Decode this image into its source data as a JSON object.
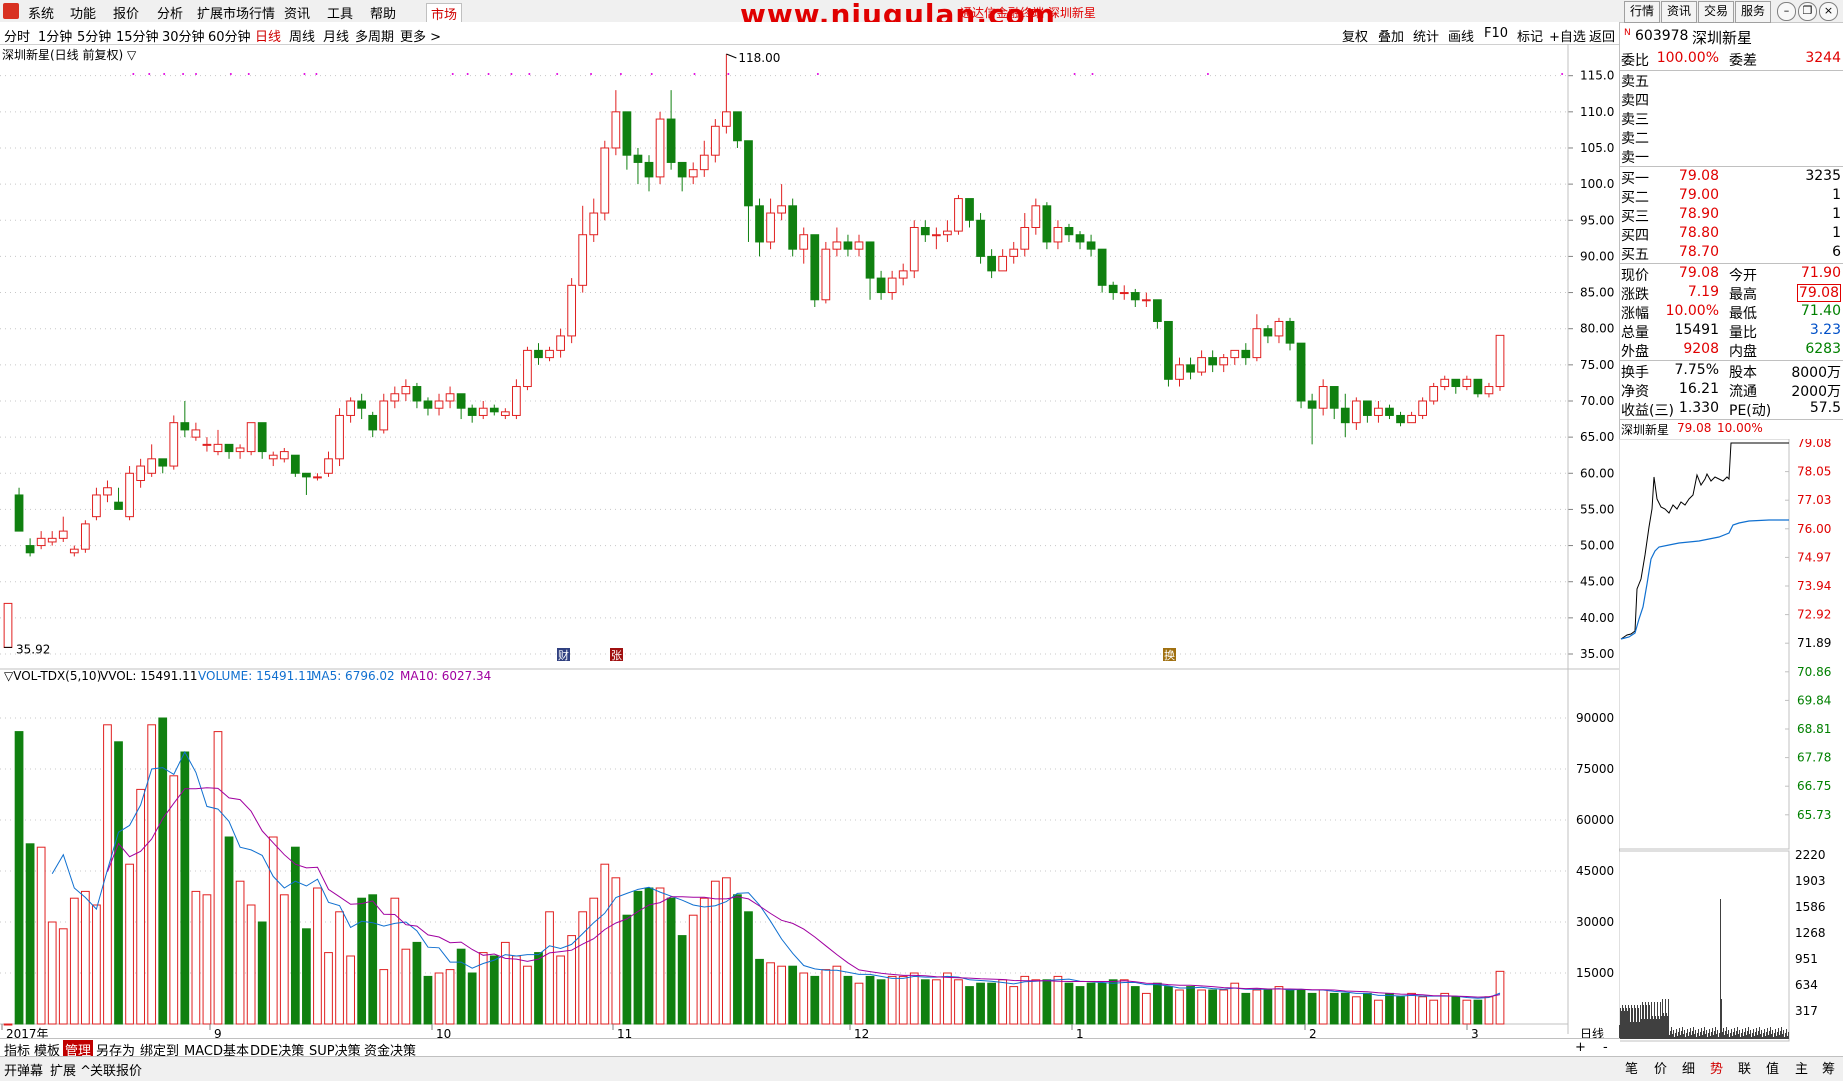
{
  "menu": {
    "items": [
      "系统",
      "功能",
      "报价",
      "分析",
      "扩展市场行情",
      "资讯",
      "工具",
      "帮助"
    ],
    "market_tab": "市场",
    "watermark": "www.niugulan.com",
    "watermark_sub": "通达信金融终端  深圳新星",
    "right_buttons": [
      "行情",
      "资讯",
      "交易",
      "服务"
    ]
  },
  "periods": {
    "items": [
      "分时",
      "1分钟",
      "5分钟",
      "15分钟",
      "30分钟",
      "60分钟",
      "日线",
      "周线",
      "月线",
      "多周期",
      "更多 >"
    ],
    "active": "日线"
  },
  "toolbar": {
    "items": [
      "复权",
      "叠加",
      "统计",
      "画线",
      "F10",
      "标记",
      "+自选",
      "返回"
    ]
  },
  "chart": {
    "title": "深圳新星(日线 前复权) ▽",
    "high_label": "118.00",
    "low_label": "35.92",
    "price_ticks": [
      "115.0",
      "110.0",
      "105.0",
      "100.0",
      "95.00",
      "90.00",
      "85.00",
      "80.00",
      "75.00",
      "70.00",
      "65.00",
      "60.00",
      "55.00",
      "50.00",
      "45.00",
      "40.00",
      "35.00"
    ],
    "volume_header": {
      "name": "▽VOL-TDX(5,10)",
      "vvol": "VVOL: 15491.11",
      "volume": "VOLUME: 15491.11",
      "ma5": "MA5: 6796.02",
      "ma10": "MA10: 6027.34"
    },
    "volume_ticks": [
      "90000",
      "75000",
      "60000",
      "45000",
      "30000",
      "15000"
    ],
    "date_ticks": [
      "2017年",
      "9",
      "10",
      "11",
      "12",
      "1",
      "2",
      "3"
    ],
    "period_label": "日线",
    "markers": [
      "财",
      "张",
      "换"
    ]
  },
  "chart_data": {
    "type": "candlestick",
    "title": "深圳新星(日线 前复权)",
    "ylim": [
      35,
      118
    ],
    "high": 118.0,
    "low": 35.92,
    "last_close": 79.08,
    "candles": [
      [
        35.9,
        42,
        42,
        35.9
      ],
      [
        57,
        52,
        58,
        52
      ],
      [
        50,
        49,
        51,
        48.5
      ],
      [
        50,
        51,
        52,
        49.5
      ],
      [
        50.5,
        51,
        52,
        50
      ],
      [
        51,
        52,
        54,
        50.5
      ],
      [
        49,
        49.5,
        50,
        48.5
      ],
      [
        49.5,
        53,
        53.5,
        49
      ],
      [
        54,
        57,
        58,
        53.5
      ],
      [
        57,
        58,
        59,
        56
      ],
      [
        56,
        55,
        58,
        55
      ],
      [
        54,
        60,
        61,
        53.5
      ],
      [
        59,
        61,
        62,
        58
      ],
      [
        60,
        62,
        64,
        59.5
      ],
      [
        62,
        61,
        62,
        60
      ],
      [
        61,
        67,
        68,
        60.5
      ],
      [
        67,
        66,
        70,
        65
      ],
      [
        65,
        66,
        67,
        64.5
      ],
      [
        64,
        64,
        65,
        63
      ],
      [
        63,
        64,
        66,
        62.5
      ],
      [
        64,
        63,
        64,
        62
      ],
      [
        63,
        63.5,
        64,
        62
      ],
      [
        63,
        67,
        67,
        62.5
      ],
      [
        67,
        63,
        67,
        62
      ],
      [
        62,
        62.5,
        63,
        61
      ],
      [
        62,
        63,
        63.5,
        61.5
      ],
      [
        62.5,
        60,
        62.5,
        59.5
      ],
      [
        60,
        59.5,
        60,
        57
      ],
      [
        59.5,
        59.5,
        60,
        59
      ],
      [
        60,
        62,
        63,
        59.5
      ],
      [
        62,
        68,
        69,
        61
      ],
      [
        68,
        70,
        70.5,
        67
      ],
      [
        70,
        69,
        71,
        67.5
      ],
      [
        68,
        66,
        68.5,
        65
      ],
      [
        66,
        70,
        71,
        65.5
      ],
      [
        70,
        71,
        72,
        69
      ],
      [
        71,
        72,
        73,
        70
      ],
      [
        72,
        70,
        72.5,
        69
      ],
      [
        70,
        69,
        70.5,
        68
      ],
      [
        69,
        70,
        71,
        68
      ],
      [
        70,
        71,
        72,
        69
      ],
      [
        71,
        69,
        71,
        67.5
      ],
      [
        69,
        68,
        69.5,
        67
      ],
      [
        68,
        69,
        70,
        67.5
      ],
      [
        69,
        68.5,
        69.5,
        68
      ],
      [
        68,
        68.5,
        69,
        67.5
      ],
      [
        68,
        72,
        73,
        67.5
      ],
      [
        72,
        77,
        77.5,
        71.5
      ],
      [
        77,
        76,
        78,
        75
      ],
      [
        76,
        77,
        77.5,
        75.5
      ],
      [
        77,
        79,
        80,
        76
      ],
      [
        79,
        86,
        87,
        78
      ],
      [
        86,
        93,
        97,
        85
      ],
      [
        93,
        96,
        98,
        92
      ],
      [
        96,
        105,
        106,
        95
      ],
      [
        105,
        110,
        113,
        104
      ],
      [
        110,
        104,
        110,
        102
      ],
      [
        104,
        103,
        105,
        100
      ],
      [
        103,
        101,
        104,
        99
      ],
      [
        101,
        109,
        110,
        100
      ],
      [
        109,
        103,
        113,
        102
      ],
      [
        103,
        101,
        103,
        99
      ],
      [
        101,
        102,
        103,
        100
      ],
      [
        102,
        104,
        106,
        101
      ],
      [
        104,
        108,
        109,
        103
      ],
      [
        108,
        110,
        118,
        107
      ],
      [
        110,
        106,
        110,
        105
      ],
      [
        106,
        97,
        106,
        92
      ],
      [
        97,
        92,
        98,
        90
      ],
      [
        92,
        96,
        98,
        91
      ],
      [
        96,
        97,
        100,
        95
      ],
      [
        97,
        91,
        98,
        90
      ],
      [
        91,
        93,
        94,
        89
      ],
      [
        93,
        84,
        93,
        83
      ],
      [
        84,
        91,
        92,
        83.5
      ],
      [
        91,
        92,
        94,
        90
      ],
      [
        92,
        91,
        93,
        90
      ],
      [
        91,
        92,
        93,
        90
      ],
      [
        92,
        87,
        92,
        84
      ],
      [
        87,
        85,
        88,
        84
      ],
      [
        85,
        87,
        88,
        84
      ],
      [
        87,
        88,
        89,
        86
      ],
      [
        88,
        94,
        95,
        87
      ],
      [
        94,
        93,
        95,
        92
      ],
      [
        93,
        93,
        94,
        91
      ],
      [
        93,
        93.5,
        95,
        92
      ],
      [
        93.5,
        98,
        98.5,
        93
      ],
      [
        98,
        95,
        98,
        94
      ],
      [
        95,
        90,
        96,
        89
      ],
      [
        90,
        88,
        91,
        87
      ],
      [
        88,
        90,
        91,
        88
      ],
      [
        90,
        91,
        92,
        89
      ],
      [
        91,
        94,
        96,
        90
      ],
      [
        94,
        97,
        98,
        93
      ],
      [
        97,
        92,
        97.5,
        91
      ],
      [
        92,
        94,
        95,
        91
      ],
      [
        94,
        93,
        94.5,
        92
      ],
      [
        93,
        92,
        93.5,
        91
      ],
      [
        92,
        91,
        93,
        90
      ],
      [
        91,
        86,
        91,
        85
      ],
      [
        86,
        85,
        86.5,
        84
      ],
      [
        85,
        85,
        86,
        84
      ],
      [
        85,
        84,
        85.5,
        83
      ],
      [
        84,
        84,
        85,
        83
      ],
      [
        84,
        81,
        84,
        80
      ],
      [
        81,
        73,
        81,
        72
      ],
      [
        73,
        75,
        76,
        72
      ],
      [
        75,
        74,
        76,
        73
      ],
      [
        74,
        76,
        77,
        73.5
      ],
      [
        76,
        75,
        77,
        74
      ],
      [
        75,
        76,
        76.5,
        74
      ],
      [
        76,
        77,
        77,
        75
      ],
      [
        77,
        76,
        78,
        75
      ],
      [
        76,
        80,
        82,
        75.5
      ],
      [
        80,
        79,
        80.5,
        78
      ],
      [
        79,
        81,
        81.5,
        78
      ],
      [
        81,
        78,
        81.5,
        77
      ],
      [
        78,
        70,
        78,
        69
      ],
      [
        70,
        69,
        71,
        64
      ],
      [
        69,
        72,
        73,
        68
      ],
      [
        72,
        69,
        72,
        67.5
      ],
      [
        69,
        67,
        71,
        65
      ],
      [
        67,
        70,
        70.5,
        66
      ],
      [
        70,
        68,
        70,
        67
      ],
      [
        68,
        69,
        70,
        67
      ],
      [
        69,
        68,
        69.5,
        67.5
      ],
      [
        68,
        67,
        68.5,
        66.5
      ],
      [
        67,
        68,
        68.5,
        67
      ],
      [
        68,
        70,
        70.5,
        67.5
      ],
      [
        70,
        72,
        72.5,
        69.5
      ],
      [
        72,
        73,
        73.5,
        71.5
      ],
      [
        73,
        72,
        73,
        71
      ],
      [
        72,
        73,
        73.5,
        71.5
      ],
      [
        73,
        71,
        73,
        70.5
      ],
      [
        71,
        72,
        72.5,
        70.5
      ],
      [
        72,
        79.08,
        79.08,
        71.4
      ]
    ],
    "volume": [
      0,
      86000,
      53000,
      52000,
      30000,
      28000,
      37000,
      39000,
      35000,
      88000,
      83000,
      47000,
      69000,
      88000,
      90000,
      73000,
      80000,
      39000,
      38000,
      86000,
      55000,
      42000,
      35000,
      30000,
      55000,
      38000,
      52000,
      28000,
      40000,
      21000,
      33000,
      20000,
      37000,
      38000,
      16000,
      37000,
      22000,
      24000,
      14000,
      15000,
      16000,
      22000,
      15000,
      21000,
      20000,
      24000,
      20000,
      17000,
      21000,
      33000,
      20000,
      26000,
      33000,
      37000,
      47000,
      43000,
      32000,
      39000,
      40000,
      40000,
      37000,
      26000,
      32000,
      37000,
      42000,
      43000,
      38000,
      33000,
      19000,
      18000,
      17000,
      17000,
      15000,
      14000,
      16000,
      17000,
      14000,
      12000,
      14000,
      13000,
      14000,
      14000,
      15000,
      13000,
      13000,
      15000,
      13000,
      11000,
      12000,
      12000,
      13000,
      11000,
      14000,
      13000,
      13000,
      14000,
      12000,
      11000,
      12000,
      12000,
      13000,
      13000,
      11000,
      9000,
      12000,
      11000,
      10000,
      11000,
      10000,
      10000,
      10000,
      12000,
      9000,
      10000,
      10000,
      11000,
      10000,
      10000,
      9000,
      10000,
      9000,
      9000,
      8000,
      9000,
      7000,
      9000,
      8000,
      9000,
      8000,
      7000,
      9000,
      8000,
      7000,
      7000,
      8000,
      15491
    ]
  },
  "quote": {
    "code": "603978",
    "name": "深圳新星",
    "weibi_label": "委比",
    "weibi": "100.00%",
    "weicha_label": "委差",
    "weicha": "3244",
    "sell": [
      {
        "label": "卖五"
      },
      {
        "label": "卖四"
      },
      {
        "label": "卖三"
      },
      {
        "label": "卖二"
      },
      {
        "label": "卖一"
      }
    ],
    "buy": [
      {
        "label": "买一",
        "price": "79.08",
        "vol": "3235"
      },
      {
        "label": "买二",
        "price": "79.00",
        "vol": "1"
      },
      {
        "label": "买三",
        "price": "78.90",
        "vol": "1"
      },
      {
        "label": "买四",
        "price": "78.80",
        "vol": "1"
      },
      {
        "label": "买五",
        "price": "78.70",
        "vol": "6"
      }
    ],
    "stats": [
      {
        "l": "现价",
        "v": "79.08",
        "l2": "今开",
        "v2": "71.90"
      },
      {
        "l": "涨跌",
        "v": "7.19",
        "l2": "最高",
        "v2": "79.08"
      },
      {
        "l": "涨幅",
        "v": "10.00%",
        "l2": "最低",
        "v2": "71.40"
      },
      {
        "l": "总量",
        "v": "15491",
        "l2": "量比",
        "v2": "3.23"
      },
      {
        "l": "外盘",
        "v": "9208",
        "l2": "内盘",
        "v2": "6283"
      }
    ],
    "stats2": [
      {
        "l": "换手",
        "v": "7.75%",
        "l2": "股本",
        "v2": "8000万"
      },
      {
        "l": "净资",
        "v": "16.21",
        "l2": "流通",
        "v2": "2000万"
      },
      {
        "l": "收益(三)",
        "v": "1.330",
        "l2": "PE(动)",
        "v2": "57.5"
      }
    ],
    "mini_title": "深圳新星",
    "mini_price": "79.08",
    "mini_pct": "10.00%",
    "mini_ticks": [
      "79.08",
      "78.05",
      "77.03",
      "76.00",
      "74.97",
      "73.94",
      "72.92",
      "71.89",
      "70.86",
      "69.84",
      "68.81",
      "67.78",
      "66.75",
      "65.73"
    ],
    "mini_vol_ticks": [
      "2220",
      "1903",
      "1586",
      "1268",
      "951",
      "634",
      "317"
    ]
  },
  "bottom_tabs": {
    "items": [
      "指标",
      "模板",
      "管理",
      "另存为",
      "绑定到",
      "MACD基本",
      "DDE决策",
      "SUP决策",
      "资金决策"
    ],
    "active": "管理",
    "extra": [
      "开弹幕",
      "扩展 ^",
      "关联报价"
    ],
    "right": [
      "笔",
      "价",
      "细",
      "势",
      "联",
      "值",
      "主",
      "筹"
    ],
    "right_active": "势"
  }
}
